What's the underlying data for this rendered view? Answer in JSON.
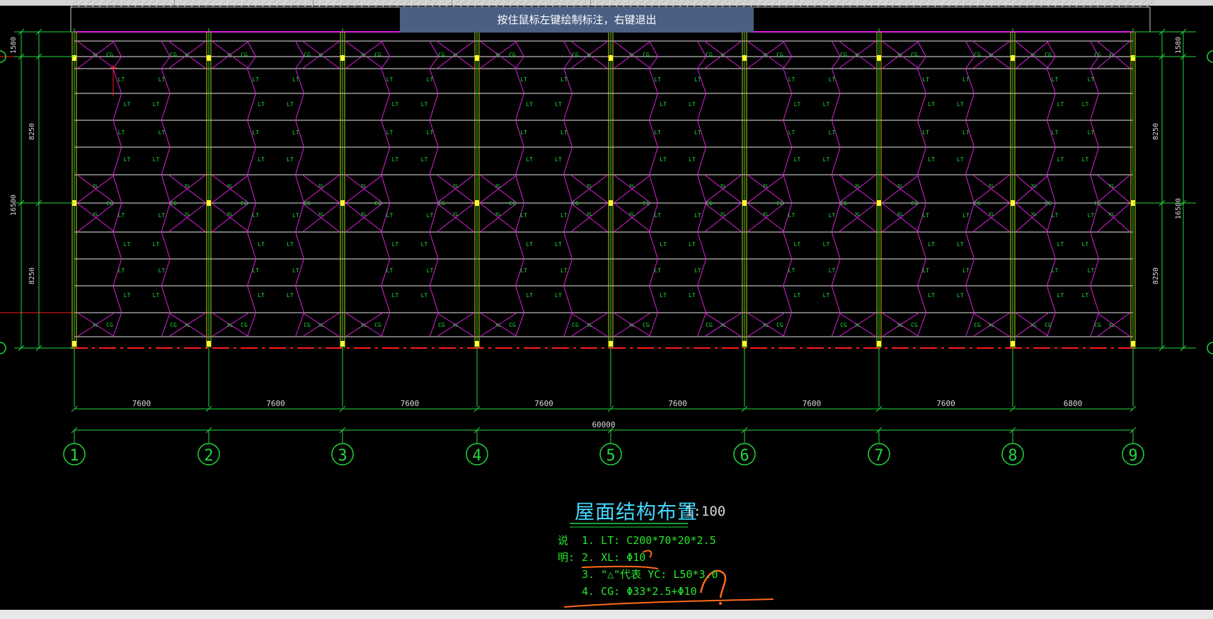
{
  "tooltip": "按住鼠标左键绘制标注，右键退出",
  "drawing": {
    "title": "屋面结构布置",
    "scale": "1:100",
    "notes_prefix": "说明:",
    "notes": [
      "1. LT: C200*70*20*2.5",
      "2. XL: Φ10",
      "3. \"△\"代表 YC: L50*3.0",
      "4. CG: Φ33*2.5+Φ10"
    ],
    "axes": [
      "1",
      "2",
      "3",
      "4",
      "5",
      "6",
      "7",
      "8",
      "9"
    ],
    "bay_dims": [
      "7600",
      "7600",
      "7600",
      "7600",
      "7600",
      "7600",
      "7600",
      "6800"
    ],
    "total_dim": "60000",
    "left_dims": {
      "top": "1580",
      "upper": "8250",
      "total": "16500",
      "lower": "8250"
    },
    "right_dims": {
      "top": "1580",
      "upper": "8250",
      "total": "16500",
      "lower": "8250"
    },
    "member_labels": {
      "purlin": "LT",
      "brace": "XL",
      "strut": "CG"
    }
  },
  "colors": {
    "grid": "#22d83c",
    "axis": "#ff1a1a",
    "brace": "#e020e0",
    "purlin": "#e6e6e6",
    "title": "#43d8ff",
    "markup": "#ff6a1a",
    "tooltip_bg": "#4a5f83"
  }
}
